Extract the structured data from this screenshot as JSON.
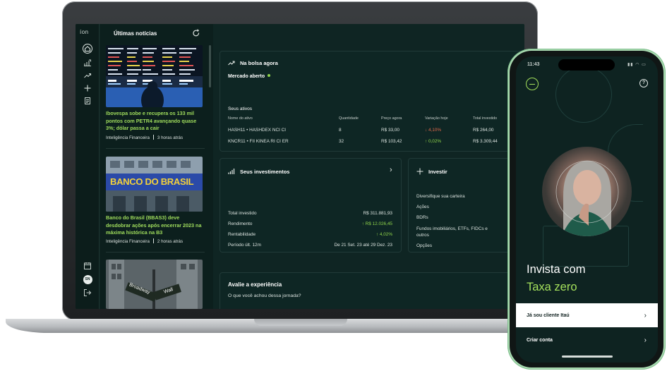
{
  "sidebar": {
    "logo": "íon",
    "user_initials": "SN"
  },
  "news": {
    "title": "Últimas notícias",
    "items": [
      {
        "headline": "Ibovespa sobe e recupera os 133 mil pontos com PETR4 avançando quase 3%; dólar passa a cair",
        "source": "Inteligência Financeira",
        "time": "3 horas atrás"
      },
      {
        "headline": "Banco do Brasil (BBAS3) deve desdobrar ações após encerrar 2023 na máxima histórica na B3",
        "source": "Inteligência Financeira",
        "time": "2 horas atrás",
        "image_text": "BANCO DO BRASIL"
      },
      {
        "image_text_1": "Broadway",
        "image_text_2": "Wall"
      }
    ]
  },
  "market": {
    "title": "Na bolsa agora",
    "status": "Mercado aberto",
    "assets_title": "Seus ativos",
    "columns": [
      "Nome do ativo",
      "Quantidade",
      "Preço agora",
      "Variação hoje",
      "Total investido"
    ],
    "rows": [
      {
        "name": "HASH11 • HASHDEX NCI CI",
        "qty": "8",
        "price": "R$ 33,00",
        "change": "↓ 4,10%",
        "total": "R$ 264,00"
      },
      {
        "name": "KNCR11 • FII KINEA RI CI ER",
        "qty": "32",
        "price": "R$ 103,42",
        "change": "↑ 0,02%",
        "total": "R$ 3.309,44"
      }
    ]
  },
  "investments": {
    "title": "Seus investimentos",
    "rows": [
      {
        "label": "Total investido",
        "value": "R$ 311.881,93"
      },
      {
        "label": "Rendimento",
        "value": "↑ R$ 12.026,45"
      },
      {
        "label": "Rentabilidade",
        "value": "↑ 4,02%"
      },
      {
        "label": "Período últ. 12m",
        "value": "De 21 Set. 23 até 29 Dez. 23"
      }
    ]
  },
  "invest": {
    "title": "Investir",
    "subtitle": "Diversifique sua carteira",
    "items": [
      "Ações",
      "BDRs",
      "Fundos imobiliários, ETFs, FIDCs e outros",
      "Opções"
    ]
  },
  "feedback": {
    "title": "Avalie a experiência",
    "question": "O que você achou dessa jornada?"
  },
  "phone": {
    "time": "11:43",
    "hero_line1": "Invista com",
    "hero_line2": "Taxa zero",
    "primary_button": "Já sou cliente Itaú",
    "secondary_button": "Criar conta",
    "help": "?"
  },
  "colors": {
    "accent": "#a4e05c",
    "background": "#0f2523",
    "negative": "#e0684a"
  }
}
